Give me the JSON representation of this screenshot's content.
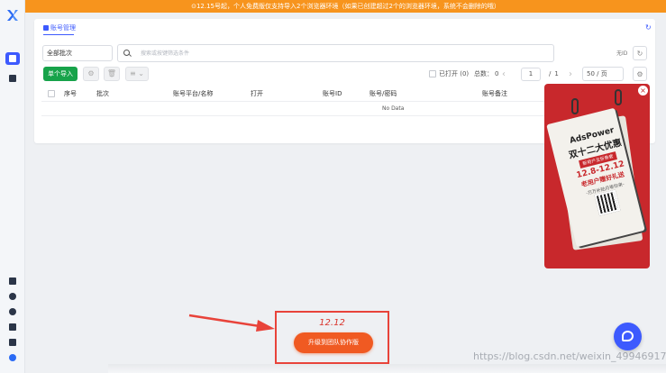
{
  "banner": {
    "text": "⊙12.15号起，个人免费版仅支持导入2个浏览器环境（如果已创建超过2个的浏览器环境，系统不会删除的哦）"
  },
  "sidebar": {
    "items": [
      "list-icon",
      "id-card-icon",
      "note-icon",
      "help-icon",
      "moon-icon",
      "screen-icon",
      "sliders-icon",
      "user-icon"
    ]
  },
  "tab": {
    "label": "账号管理"
  },
  "filter": {
    "batch_select": "全部批次",
    "search_placeholder": "搜索或按键筛选条件",
    "mini_label": "无ID",
    "refresh_icon": "↻"
  },
  "toolbar": {
    "import_label": "单个导入",
    "settings_icon": "⚙",
    "delete_icon": "🗑",
    "more_icon": "≡ ⌄"
  },
  "pager": {
    "opened_label": "已打开 (0)",
    "total_label": "总数：",
    "total_value": "0",
    "prev": "‹",
    "page": "1",
    "page_sep": "/",
    "page_total": "1",
    "next": "›",
    "per_page": "50 / 页",
    "gear": "⚙"
  },
  "table": {
    "columns": [
      "序号",
      "批次",
      "账号平台/名称",
      "打开",
      "账号ID",
      "账号/密码",
      "账号备注"
    ],
    "empty_text": "No Data"
  },
  "ad": {
    "brand": "AdsPower",
    "title": "双十二大优惠",
    "tag": "新用户五折券套",
    "date": "12.8-12.12",
    "gift": "老用户赠好礼送",
    "sub": "-万万补贴月等你来-",
    "close": "×"
  },
  "promo": {
    "title": "12.12",
    "button": "升级到团队协作版"
  },
  "watermark": "https://blog.csdn.net/weixin_49946917",
  "colors": {
    "accent": "#3d5afe",
    "banner": "#f7941d",
    "import": "#17a34a",
    "promo": "#f05a22",
    "ad": "#c8282c"
  }
}
